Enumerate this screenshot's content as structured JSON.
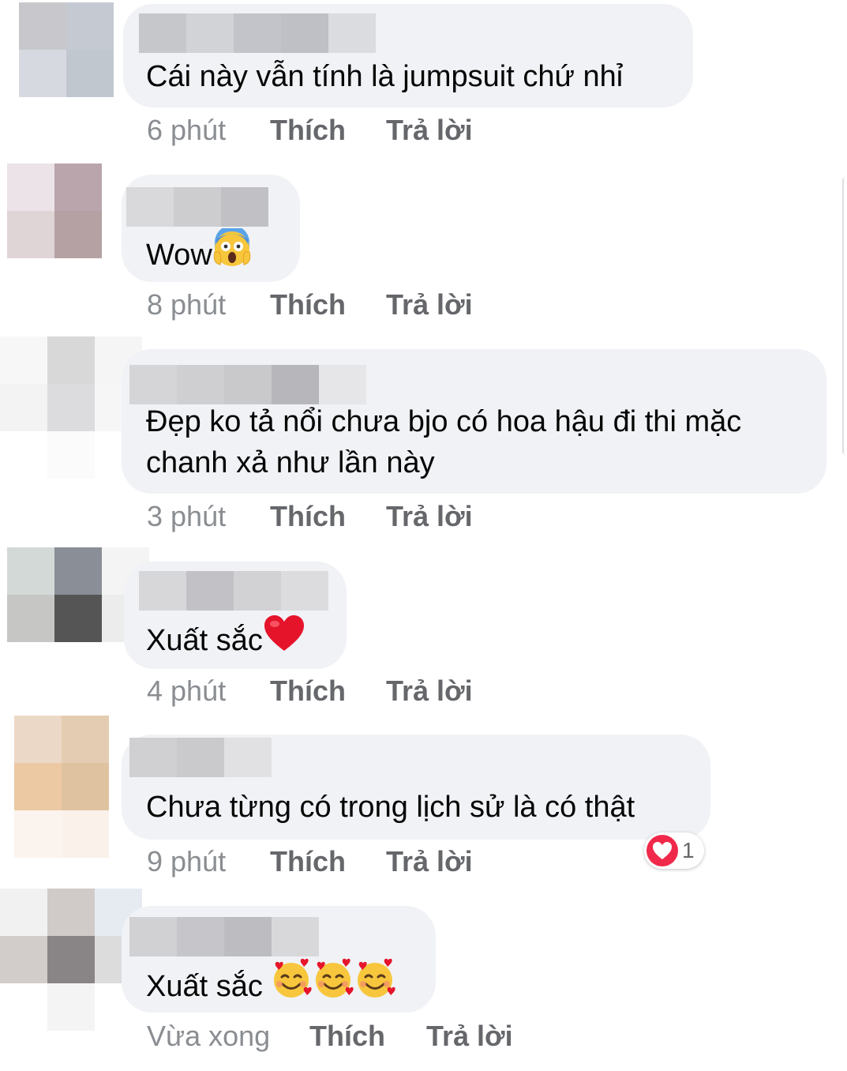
{
  "comments": [
    {
      "text": "Cái này vẫn tính là jumpsuit chứ nhỉ",
      "time": "6 phút",
      "like_label": "Thích",
      "reply_label": "Trả lời",
      "avatar_colors": [
        "#c8c8cc",
        "#c5cad2",
        "#ffffff",
        "#d6d9e0",
        "#c1c7cf",
        "#ffffff",
        "#ffffff",
        "#ffffff",
        "#ffffff"
      ],
      "name_colors": [
        "#c6c7cb",
        "#d2d3d7",
        "#c3c4c9",
        "#bfc0c5",
        "#dbdce0"
      ]
    },
    {
      "text": "Wow",
      "emoji": "scream-emoji",
      "time": "8 phút",
      "like_label": "Thích",
      "reply_label": "Trả lời",
      "avatar_colors": [
        "#ece3e8",
        "#baa5ac",
        "#ffffff",
        "#dfd4d6",
        "#b5a1a3",
        "#ffffff",
        "#ffffff",
        "#ffffff",
        "#ffffff"
      ],
      "name_colors": [
        "#d9d9dc",
        "#cdcdd0",
        "#c1c1c5"
      ]
    },
    {
      "text": "Đẹp ko tả nổi chưa bjo có hoa hậu đi thi mặc chanh xả như lần này",
      "time": "3 phút",
      "like_label": "Thích",
      "reply_label": "Trả lời",
      "avatar_colors": [
        "#f7f7f7",
        "#d8d8d8",
        "#f5f5f5",
        "#f3f3f4",
        "#dcdcde",
        "#f6f6f6",
        "#ffffff",
        "#fbfbfb",
        "#ffffff"
      ],
      "name_colors": [
        "#d5d5d8",
        "#cfcfd2",
        "#c9c9cc",
        "#b7b7bb",
        "#e6e6e8"
      ]
    },
    {
      "text": "Xuất sắc",
      "emoji": "red-heart-emoji",
      "time": "4 phút",
      "like_label": "Thích",
      "reply_label": "Trả lời",
      "avatar_colors": [
        "#d3d9d6",
        "#8a8e96",
        "#f4f4f4",
        "#c6c6c4",
        "#555555",
        "#ececec",
        "#ffffff",
        "#ffffff",
        "#ffffff"
      ],
      "name_colors": [
        "#d7d7da",
        "#c2c2c6",
        "#d2d2d5",
        "#dcdcdf"
      ]
    },
    {
      "text": "Chưa từng có trong lịch sử là có thật",
      "time": "9 phút",
      "like_label": "Thích",
      "reply_label": "Trả lời",
      "reaction_count": "1",
      "avatar_colors": [
        "#ecd8c6",
        "#e4ccb2",
        "#ffffff",
        "#ecc9a3",
        "#dfc3a0",
        "#ffffff",
        "#fbf4ee",
        "#faf1ea",
        "#ffffff"
      ],
      "name_colors": [
        "#d0d0d3",
        "#cacacd",
        "#e1e1e3"
      ]
    },
    {
      "text": "Xuất sắc",
      "emoji": "smiling-face-with-hearts-emoji",
      "time": "Vừa xong",
      "like_label": "Thích",
      "reply_label": "Trả lời",
      "avatar_colors": [
        "#f2f1f1",
        "#d0cac8",
        "#e6ebf2",
        "#d2cccb",
        "#898586",
        "#dcdcdc",
        "#ffffff",
        "#f5f4f4",
        "#ffffff"
      ],
      "name_colors": [
        "#d1d1d4",
        "#c6c6ca",
        "#bdbdc1",
        "#d8d8db"
      ]
    }
  ]
}
